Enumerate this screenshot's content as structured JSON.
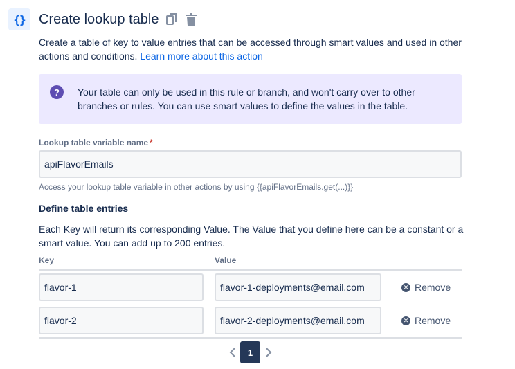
{
  "header": {
    "title": "Create lookup table",
    "icons": [
      "braces-icon",
      "copy-icon",
      "trash-icon"
    ]
  },
  "description": {
    "text": "Create a table of key to value entries that can be accessed through smart values and used in other actions and conditions.",
    "link": "Learn more about this action"
  },
  "info_panel": {
    "icon": "question-circle-icon",
    "text": "Your table can only be used in this rule or branch, and won't carry over to other branches or rules. You can use smart values to define the values in the table."
  },
  "variable_field": {
    "label": "Lookup table variable name",
    "required_marker": "*",
    "value": "apiFlavorEmails",
    "helper": "Access your lookup table variable in other actions by using {{apiFlavorEmails.get(...)}}"
  },
  "entries_section": {
    "title": "Define table entries",
    "description": "Each Key will return its corresponding Value. The Value that you define here can be a constant or a smart value. You can add up to 200 entries.",
    "key_header": "Key",
    "value_header": "Value",
    "rows": [
      {
        "key": "flavor-1",
        "value": "flavor-1-deployments@email.com",
        "remove_label": "Remove"
      },
      {
        "key": "flavor-2",
        "value": "flavor-2-deployments@email.com",
        "remove_label": "Remove"
      }
    ]
  },
  "pagination": {
    "current_page": "1",
    "prev_icon": "chevron-left-icon",
    "next_icon": "chevron-right-icon"
  },
  "colors": {
    "accent": "#0c66e4",
    "info_bg": "#ece9ff",
    "info_icon": "#5e4db2",
    "page_selected": "#253858"
  }
}
